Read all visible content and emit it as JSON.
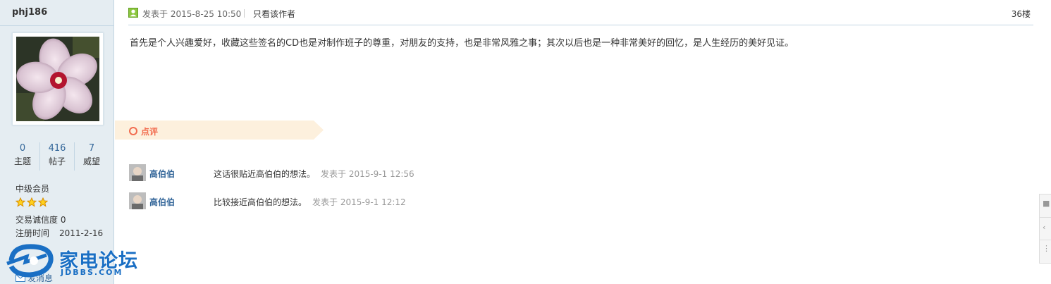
{
  "author": {
    "username": "phj186",
    "stats": [
      {
        "value": "0",
        "label": "主题"
      },
      {
        "value": "416",
        "label": "帖子"
      },
      {
        "value": "7",
        "label": "威望"
      }
    ],
    "rank": "中级会员",
    "star_count": 3,
    "trade_credit": "交易诚信度 0",
    "reg_label": "注册时间",
    "reg_date": "2011-2-16",
    "send_message": "发消息"
  },
  "post": {
    "posted_at": "发表于 2015-8-25 10:50",
    "only_author": "只看该作者",
    "floor": "36楼",
    "content": "首先是个人兴趣爱好，收藏这些签名的CD也是对制作班子的尊重，对朋友的支持，也是非常风雅之事；其次以后也是一种非常美好的回忆，是人生经历的美好见证。"
  },
  "comments": {
    "title": "点评",
    "items": [
      {
        "user": "高伯伯",
        "text": "这话很贴近高伯伯的想法。",
        "time": "发表于 2015-9-1 12:56"
      },
      {
        "user": "高伯伯",
        "text": "比较接近高伯伯的想法。",
        "time": "发表于 2015-9-1 12:12"
      }
    ]
  },
  "logo": {
    "brand": "家电论坛",
    "domain": "JDBBS.COM"
  },
  "colors": {
    "sidebar_bg": "#e5edf2",
    "border": "#c2d5e3",
    "link": "#336699",
    "comment_accent": "#f26c4f",
    "banner_bg": "#fdf0dd",
    "brand_blue": "#1a6fc4"
  }
}
